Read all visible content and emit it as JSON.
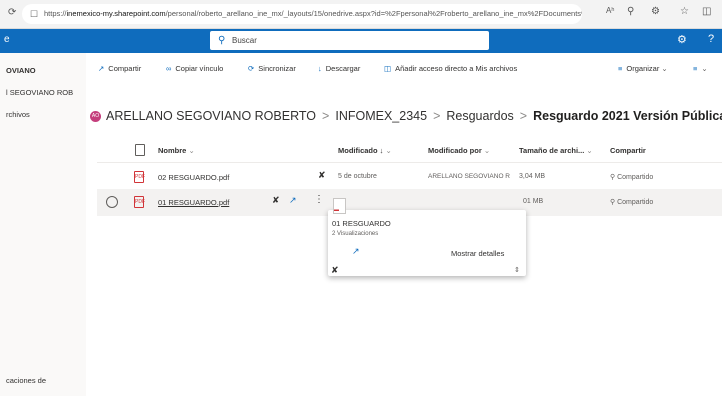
{
  "browser": {
    "url_prefix": "https://",
    "url_domain": "inemexico-my.sharepoint.com",
    "url_rest": "/personal/roberto_arellano_ine_mx/_layouts/15/onedrive.aspx?id=%2Fpersonal%2Froberto_arellano_ine_mx%2FDocuments%2Fl...",
    "font_size_btn": "Aʰ"
  },
  "suite": {
    "app_fragment": "e",
    "search_placeholder": "Buscar"
  },
  "sidebar": {
    "user_short": "OVIANO",
    "user_full": "l SEGOVIANO ROB",
    "files_label": "rchivos",
    "footer_label": "caciones de"
  },
  "commandbar": {
    "share": "Compartir",
    "copy_link": "Copiar vínculo",
    "sync": "Sincronizar",
    "download": "Descargar",
    "shortcut": "Añadir acceso directo a Mis archivos",
    "organize": "Organizar"
  },
  "breadcrumb": {
    "avatar_initials": "AO",
    "items": [
      "ARELLANO SEGOVIANO ROBERTO",
      "INFOMEX_2345",
      "Resguardos"
    ],
    "current": "Resguardo 2021 Versión Pública"
  },
  "columns": {
    "name": "Nombre",
    "modified": "Modificado ↓",
    "modified_by": "Modificado por",
    "size": "Tamaño de archi...",
    "share": "Compartir"
  },
  "files": [
    {
      "name": "02 RESGUARDO.pdf",
      "modified": "5 de octubre",
      "modified_by": "ARELLANO SEGOVIANO R",
      "size": "3,04 MB",
      "sharing": "Compartido"
    },
    {
      "name": "01 RESGUARDO.pdf",
      "modified": "",
      "modified_by": "",
      "size": "01 MB",
      "sharing": "Compartido"
    }
  ],
  "hovercard": {
    "title": "01 RESGUARDO",
    "views": "2 Visualizaciones",
    "details": "Mostrar detalles"
  },
  "colors": {
    "accent": "#0f6cbd",
    "pdf": "#d13438",
    "avatar": "#c43e7c"
  }
}
